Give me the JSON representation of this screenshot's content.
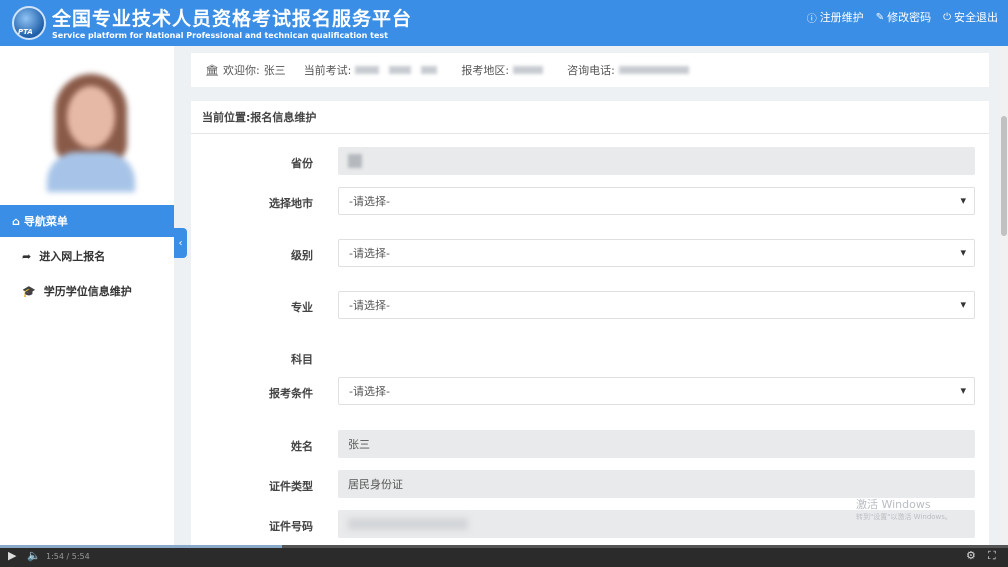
{
  "header": {
    "logo_text": "PTA",
    "title_cn": "全国专业技术人员资格考试报名服务平台",
    "title_en": "Service platform for National Professional and technican qualification test",
    "links": [
      {
        "icon": "info-icon",
        "label": "注册维护"
      },
      {
        "icon": "edit-icon",
        "label": "修改密码"
      },
      {
        "icon": "power-icon",
        "label": "安全退出"
      }
    ]
  },
  "infobar": {
    "welcome_label": "欢迎你:",
    "user_name": "张三",
    "exam_label": "当前考试:",
    "region_label": "报考地区:",
    "phone_label": "咨询电话:"
  },
  "sidebar": {
    "nav_head": "导航菜单",
    "items": [
      {
        "icon": "share-arrow-icon",
        "label": "进入网上报名"
      },
      {
        "icon": "graduation-cap-icon",
        "label": "学历学位信息维护"
      }
    ]
  },
  "main": {
    "breadcrumb": "当前位置:报名信息维护",
    "fields": {
      "province": {
        "label": "省份"
      },
      "city": {
        "label": "选择地市",
        "placeholder": "-请选择-"
      },
      "level": {
        "label": "级别",
        "placeholder": "-请选择-"
      },
      "major": {
        "label": "专业",
        "placeholder": "-请选择-"
      },
      "subject": {
        "label": "科目"
      },
      "condition": {
        "label": "报考条件",
        "placeholder": "-请选择-"
      },
      "name": {
        "label": "姓名",
        "value": "张三"
      },
      "id_type": {
        "label": "证件类型",
        "value": "居民身份证"
      },
      "id_number": {
        "label": "证件号码"
      }
    }
  },
  "watermark": {
    "line1": "激活 Windows",
    "line2": "转到\"设置\"以激活 Windows。"
  },
  "video": {
    "time": "1:54 / 5:54",
    "progress_fraction": 0.28
  },
  "colors": {
    "accent": "#3a8ee6",
    "field_readonly": "#e9eaeb"
  }
}
